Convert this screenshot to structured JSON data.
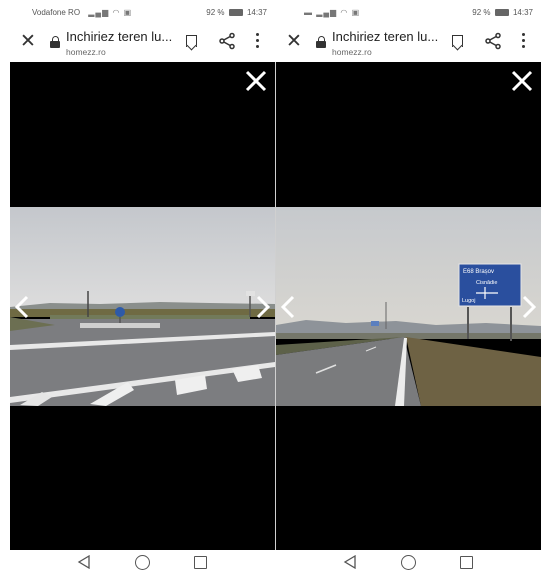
{
  "screens": [
    {
      "status": {
        "carrier": "Vodafone RO",
        "signal_icons": "▂▄▆ ◠ ▣",
        "battery": "92 %",
        "time": "14:37"
      },
      "browser": {
        "title": "Inchiriez teren lu...",
        "domain": "homezz.ro"
      },
      "photo": {
        "description_icon": "road-intersection-photo"
      }
    },
    {
      "status": {
        "carrier": "",
        "signal_icons": "▬ ▂▄▆ ◠ ▣",
        "battery": "92 %",
        "time": "14:37"
      },
      "browser": {
        "title": "Inchiriez teren lu...",
        "domain": "homezz.ro"
      },
      "photo": {
        "description_icon": "highway-road-sign-photo",
        "sign_lines": [
          "E68 Brașov",
          "Cisnădie",
          "Lugoj"
        ]
      }
    }
  ],
  "colors": {
    "viewer_bg": "#000000",
    "sign_blue": "#2a4f9e",
    "sky": "#c9ccd1"
  }
}
